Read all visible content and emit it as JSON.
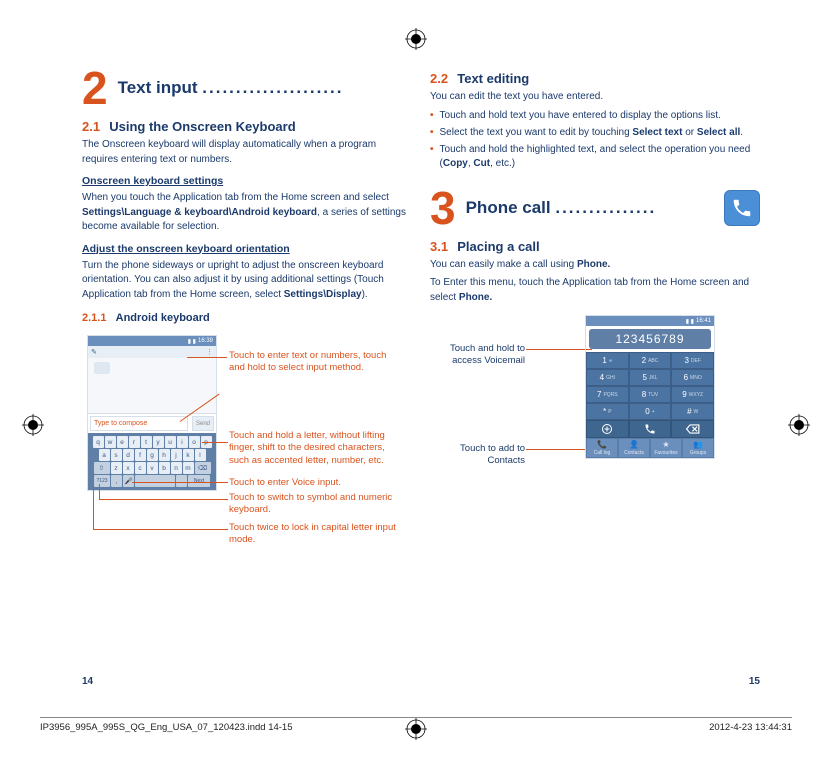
{
  "chapter2": {
    "num": "2",
    "title": "Text input",
    "dots": "....................."
  },
  "sec21": {
    "num": "2.1",
    "title": "Using the Onscreen Keyboard",
    "intro": "The Onscreen keyboard will display automatically when a program requires entering text or numbers.",
    "h1": "Onscreen keyboard settings",
    "p1a": "When you touch the Application tab from the Home screen and select ",
    "p1b": "Settings\\Language & keyboard\\Android keyboard",
    "p1c": ", a series of settings become available for selection.",
    "h2": "Adjust the onscreen keyboard orientation",
    "p2a": "Turn the phone sideways or upright to adjust the onscreen keyboard orientation. You can also adjust it by using additional settings (Touch Application tab from the Home screen, select ",
    "p2b": "Settings\\Display",
    "p2c": ")."
  },
  "sec211": {
    "num": "2.1.1",
    "title": "Android keyboard"
  },
  "kb": {
    "status_time": "16:39",
    "compose_placeholder": "Type to compose",
    "send": "Send",
    "row1": [
      "q",
      "w",
      "e",
      "r",
      "t",
      "y",
      "u",
      "i",
      "o",
      "p"
    ],
    "row2": [
      "a",
      "s",
      "d",
      "f",
      "g",
      "h",
      "j",
      "k",
      "l"
    ],
    "row3_shift": "⇧",
    "row3": [
      "z",
      "x",
      "c",
      "v",
      "b",
      "n",
      "m"
    ],
    "row3_del": "⌫",
    "sym": "?123",
    "mic": "🎤",
    "next": "Next",
    "annot1": "Touch to enter text or numbers, touch and hold to select input method.",
    "annot2": "Touch and hold a letter, without lifting finger, shift to the desired characters, such as accented letter, number, etc.",
    "annot3": "Touch to enter Voice input.",
    "annot4": "Touch to switch to symbol and numeric keyboard.",
    "annot5": "Touch twice to lock in capital letter input mode."
  },
  "sec22": {
    "num": "2.2",
    "title": "Text editing",
    "intro": "You can edit the text you have entered.",
    "b1": "Touch and hold text you have entered to display the options list.",
    "b2a": "Select the text you want to edit by touching ",
    "b2b": "Select text",
    "b2c": " or ",
    "b2d": "Select all",
    "b2e": ".",
    "b3a": "Touch and hold the highlighted text, and select the operation you need (",
    "b3b": "Copy",
    "b3c": ", ",
    "b3d": "Cut",
    "b3e": ", etc.)"
  },
  "chapter3": {
    "num": "3",
    "title": "Phone call",
    "dots": "..............."
  },
  "sec31": {
    "num": "3.1",
    "title": "Placing a call",
    "p1a": "You can easily make a call using ",
    "p1b": "Phone.",
    "p2a": "To Enter this menu, touch the Application tab from the Home screen and select ",
    "p2b": "Phone."
  },
  "dialer": {
    "status_time": "16:41",
    "display": "123456789",
    "keys": [
      {
        "n": "1",
        "s": "∞"
      },
      {
        "n": "2",
        "s": "ABC"
      },
      {
        "n": "3",
        "s": "DEF"
      },
      {
        "n": "4",
        "s": "GHI"
      },
      {
        "n": "5",
        "s": "JKL"
      },
      {
        "n": "6",
        "s": "MNO"
      },
      {
        "n": "7",
        "s": "PQRS"
      },
      {
        "n": "8",
        "s": "TUV"
      },
      {
        "n": "9",
        "s": "WXYZ"
      },
      {
        "n": "*",
        "s": "P"
      },
      {
        "n": "0",
        "s": "+"
      },
      {
        "n": "#",
        "s": "W"
      }
    ],
    "tabs": [
      "Call log",
      "Contacts",
      "Favourites",
      "Groups"
    ],
    "annot_vm": "Touch and hold to access Voicemail",
    "annot_add": "Touch to add to Contacts"
  },
  "page_numbers": {
    "left": "14",
    "right": "15"
  },
  "footer": {
    "file": "IP3956_995A_995S_QG_Eng_USA_07_120423.indd   14-15",
    "datetime": "2012-4-23   13:44:31"
  }
}
